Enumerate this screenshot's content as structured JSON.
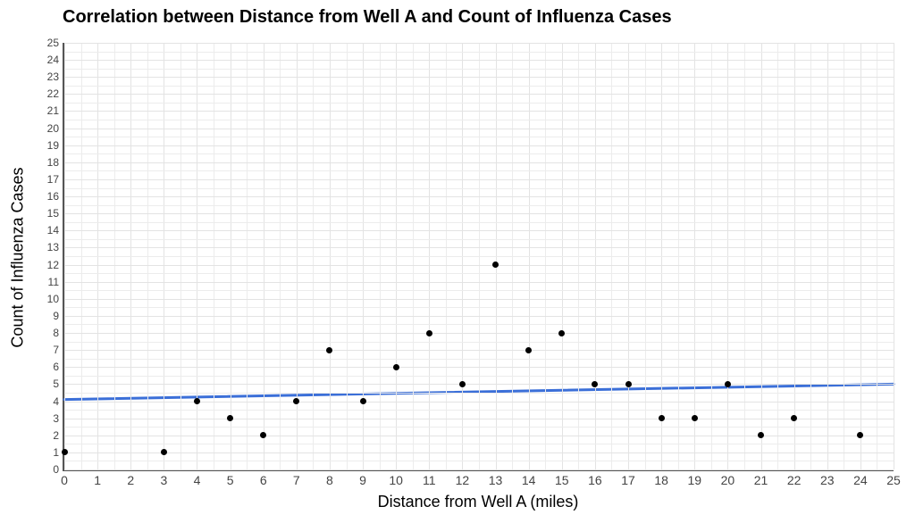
{
  "chart_data": {
    "type": "scatter",
    "title": "Correlation between Distance from Well A and Count of Influenza Cases",
    "xlabel": "Distance from Well A (miles)",
    "ylabel": "Count of Influenza Cases",
    "xlim": [
      0,
      25
    ],
    "ylim": [
      0,
      25
    ],
    "x_ticks": [
      0,
      1,
      2,
      3,
      4,
      5,
      6,
      7,
      8,
      9,
      10,
      11,
      12,
      13,
      14,
      15,
      16,
      17,
      18,
      19,
      20,
      21,
      22,
      23,
      24,
      25
    ],
    "y_ticks": [
      0,
      1,
      2,
      3,
      4,
      5,
      6,
      7,
      8,
      9,
      10,
      11,
      12,
      13,
      14,
      15,
      16,
      17,
      18,
      19,
      20,
      21,
      22,
      23,
      24,
      25
    ],
    "points": [
      {
        "x": 0,
        "y": 1
      },
      {
        "x": 3,
        "y": 1
      },
      {
        "x": 4,
        "y": 4
      },
      {
        "x": 5,
        "y": 3
      },
      {
        "x": 6,
        "y": 2
      },
      {
        "x": 7,
        "y": 4
      },
      {
        "x": 8,
        "y": 7
      },
      {
        "x": 9,
        "y": 4
      },
      {
        "x": 10,
        "y": 6
      },
      {
        "x": 11,
        "y": 8
      },
      {
        "x": 12,
        "y": 5
      },
      {
        "x": 13,
        "y": 12
      },
      {
        "x": 14,
        "y": 7
      },
      {
        "x": 15,
        "y": 8
      },
      {
        "x": 16,
        "y": 5
      },
      {
        "x": 17,
        "y": 5
      },
      {
        "x": 18,
        "y": 3
      },
      {
        "x": 19,
        "y": 3
      },
      {
        "x": 20,
        "y": 5
      },
      {
        "x": 21,
        "y": 2
      },
      {
        "x": 22,
        "y": 3
      },
      {
        "x": 24,
        "y": 2
      }
    ],
    "trend_line": {
      "x1": 0,
      "y1": 4.1,
      "x2": 25,
      "y2": 5.0,
      "color": "#3b6fd8",
      "width": 3
    },
    "grid": true
  }
}
